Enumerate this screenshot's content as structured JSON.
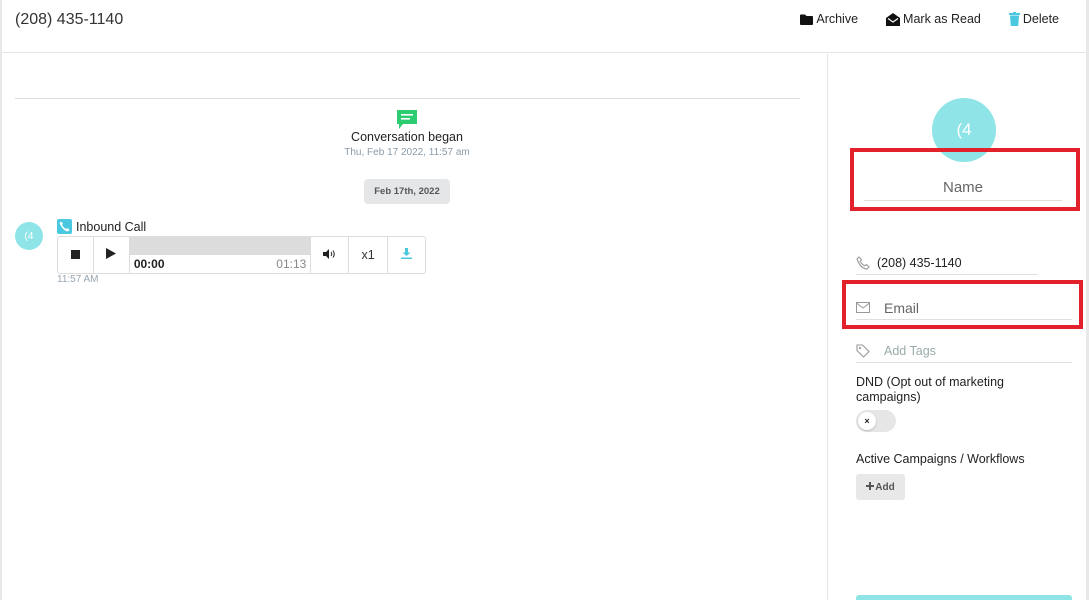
{
  "header": {
    "title": "(208) 435-1140",
    "archive_label": "Archive",
    "mark_read_label": "Mark as Read",
    "delete_label": "Delete"
  },
  "conversation": {
    "began_label": "Conversation began",
    "began_time": "Thu, Feb 17 2022, 11:57 am",
    "date_pill": "Feb 17th, 2022",
    "message": {
      "avatar_text": "(4",
      "title": "Inbound Call",
      "time": "11:57 AM",
      "player": {
        "current_time": "00:00",
        "duration": "01:13",
        "speed": "x1",
        "progress": 0
      }
    }
  },
  "contact": {
    "avatar_text": "(4",
    "name_placeholder": "Name",
    "phone": "(208) 435-1140",
    "email_placeholder": "Email",
    "tags_placeholder": "Add Tags",
    "dnd_label": "DND (Opt out of marketing campaigns)",
    "dnd_enabled": false,
    "dnd_knob": "×",
    "campaigns_label": "Active Campaigns / Workflows",
    "add_label": "Add"
  },
  "colors": {
    "accent": "#8ee4e6",
    "highlight": "#e3212b",
    "chat_icon": "#2ecc71"
  }
}
